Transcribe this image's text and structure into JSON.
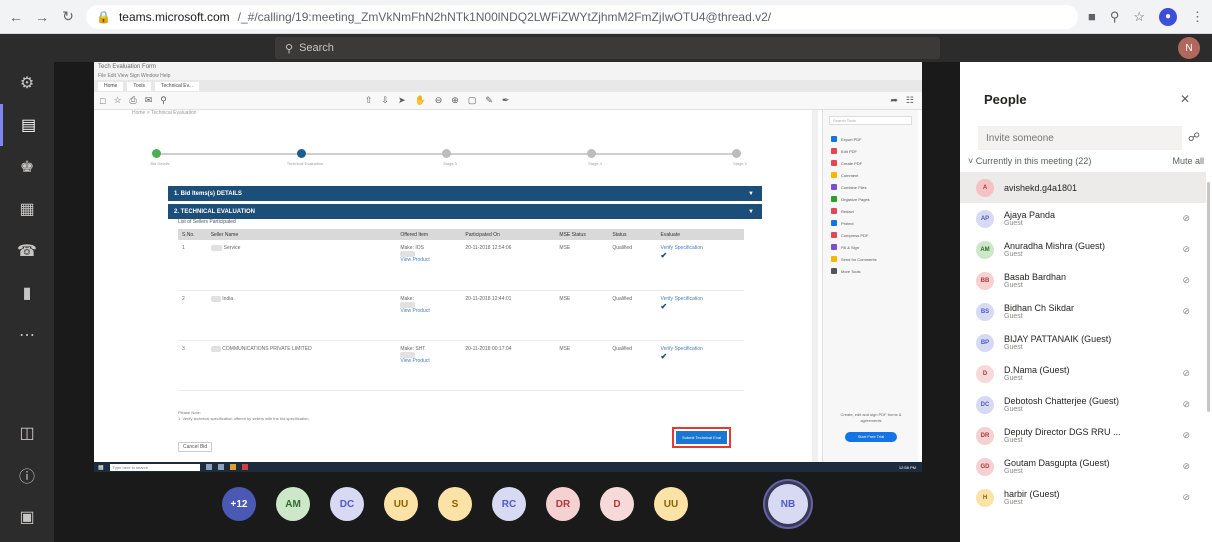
{
  "browser": {
    "url_host": "teams.microsoft.com",
    "url_path": "/_#/calling/19:meeting_ZmVkNmFhN2hNTk1N00lNDQ2LWFiZWYtZjhmM2FmZjIwOTU4@thread.v2/"
  },
  "teams": {
    "search_placeholder": "Search",
    "rail": [
      "Activity",
      "Chat",
      "Teams",
      "Calendar",
      "Calls",
      "Files",
      "...",
      "Apps",
      "Help"
    ]
  },
  "shared": {
    "window_title": "Tech Evaluation Form",
    "menu": "File Edit View Sign Window Help",
    "tabs": [
      "Home",
      "Tools",
      "Technical Ev..."
    ],
    "breadcrumb": "Home > Technical Evaluation",
    "steps": [
      "Bid Details",
      "Technical Evaluation",
      "Stage 3",
      "Stage 4",
      "Stage 5"
    ],
    "section1": "1. Bid Items(s) DETAILS",
    "section2": "2. TECHNICAL EVALUATION",
    "list_title": "List of Sellers Participated",
    "columns": [
      "S.No.",
      "Seller Name",
      "Offered Item",
      "Participated On",
      "MSE Status",
      "Status",
      "Evaluate"
    ],
    "rows": [
      {
        "sno": "1",
        "seller": "Service",
        "item": "Make: IOS",
        "date": "20-11-2018 12:54:06",
        "mse": "MSE",
        "status": "Qualified",
        "action": "Verify Specification"
      },
      {
        "sno": "2",
        "seller": "India",
        "item": "Make:",
        "date": "20-11-2018 12:44:01",
        "mse": "MSE",
        "status": "Qualified",
        "action": "Verify Specification"
      },
      {
        "sno": "3",
        "seller": "COMMUNICATIONS PRIVATE LIMITED",
        "item": "Make: SHT",
        "date": "20-11-2018 00:17:04",
        "mse": "MSE",
        "status": "Qualified",
        "action": "Verify Specification"
      }
    ],
    "view_product": "View Product",
    "note_title": "Please Note:",
    "note_text": "1. Verify technical specification offered by sellers with the bid specification.",
    "cancel_label": "Cancel Bid",
    "submit_label": "Submit Technical Eval",
    "tools": [
      "Export PDF",
      "Edit PDF",
      "Create PDF",
      "Comment",
      "Combine Files",
      "Organize Pages",
      "Redact",
      "Protect",
      "Compress PDF",
      "Fill & Sign",
      "Send for Comments",
      "More Tools"
    ],
    "tools_search": "Search Tools",
    "promo": "Create, edit and sign PDF forms & agreements",
    "trial_label": "Start Free Trial",
    "taskbar_search": "Type here to search",
    "taskbar_time": "12:58 PM"
  },
  "roster": [
    {
      "label": "+12",
      "bg": "#4a5ab4",
      "fg": "#ffffff"
    },
    {
      "label": "AM",
      "bg": "#cde8c8",
      "fg": "#2e6b2e"
    },
    {
      "label": "DC",
      "bg": "#d8daf3",
      "fg": "#5059c9"
    },
    {
      "label": "UU",
      "bg": "#fbe3a7",
      "fg": "#8a6100"
    },
    {
      "label": "S",
      "bg": "#fbe3a7",
      "fg": "#8a6100"
    },
    {
      "label": "RC",
      "bg": "#d8daf3",
      "fg": "#5059c9"
    },
    {
      "label": "DR",
      "bg": "#f6d1d1",
      "fg": "#b03a3a"
    },
    {
      "label": "D",
      "bg": "#f6dada",
      "fg": "#b03a3a"
    },
    {
      "label": "UU",
      "bg": "#fbe3a7",
      "fg": "#8a6100"
    },
    {
      "label": "NB",
      "bg": "#d8daf3",
      "fg": "#5059c9"
    }
  ],
  "people": {
    "title": "People",
    "invite_placeholder": "Invite someone",
    "section": "Currently in this meeting (22)",
    "mute_all": "Mute all",
    "list": [
      {
        "initials": "A",
        "name": "avishekd.g4a1801",
        "role": "",
        "bg": "#f3c2c2",
        "fg": "#b03a3a"
      },
      {
        "initials": "AP",
        "name": "Ajaya Panda",
        "role": "Guest",
        "bg": "#d8daf3",
        "fg": "#5059c9"
      },
      {
        "initials": "AM",
        "name": "Anuradha Mishra (Guest)",
        "role": "Guest",
        "bg": "#cde8c8",
        "fg": "#2e6b2e"
      },
      {
        "initials": "BB",
        "name": "Basab Bardhan",
        "role": "Guest",
        "bg": "#f6d1d1",
        "fg": "#b03a3a"
      },
      {
        "initials": "BS",
        "name": "Bidhan Ch Sikdar",
        "role": "Guest",
        "bg": "#d8daf3",
        "fg": "#5059c9"
      },
      {
        "initials": "BP",
        "name": "BIJAY PATTANAIK (Guest)",
        "role": "Guest",
        "bg": "#d8daf3",
        "fg": "#5059c9"
      },
      {
        "initials": "D",
        "name": "D.Nama (Guest)",
        "role": "Guest",
        "bg": "#f6dada",
        "fg": "#b03a3a"
      },
      {
        "initials": "DC",
        "name": "Debotosh Chatterjee (Guest)",
        "role": "Guest",
        "bg": "#d8daf3",
        "fg": "#5059c9"
      },
      {
        "initials": "DR",
        "name": "Deputy Director DGS RRU ...",
        "role": "Guest",
        "bg": "#f6d1d1",
        "fg": "#b03a3a"
      },
      {
        "initials": "GD",
        "name": "Goutam Dasgupta (Guest)",
        "role": "Guest",
        "bg": "#f6d1d1",
        "fg": "#b03a3a"
      },
      {
        "initials": "H",
        "name": "harbir (Guest)",
        "role": "Guest",
        "bg": "#fbe3a7",
        "fg": "#8a6100"
      }
    ]
  },
  "me_initial": "N"
}
